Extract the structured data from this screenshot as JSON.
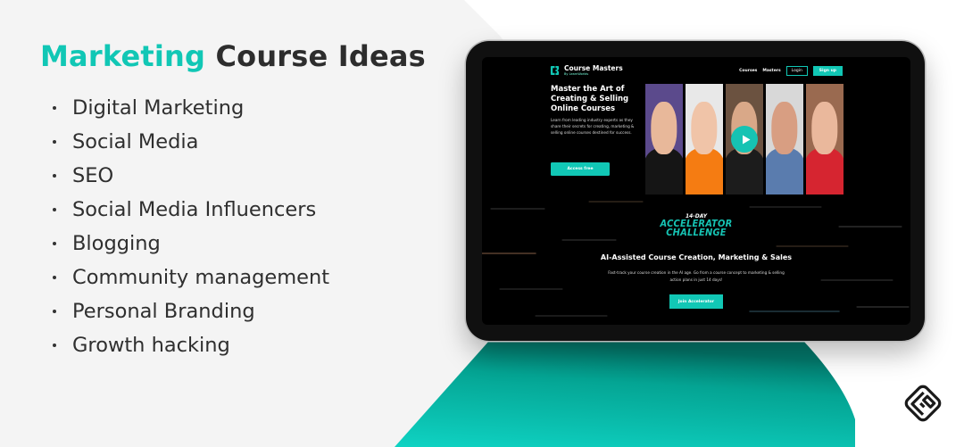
{
  "graphic": {
    "title_accent": "Marketing",
    "title_rest": " Course Ideas",
    "ideas": [
      "Digital Marketing",
      "Social Media",
      "SEO",
      "Social Media Influencers",
      "Blogging",
      "Community management",
      "Personal Branding",
      "Growth hacking"
    ],
    "accent_color": "#11c7b5"
  },
  "site": {
    "brand_name": "Course Masters",
    "brand_sub": "By LearnWorlds",
    "nav": {
      "courses": "Courses",
      "masters": "Masters",
      "login": "Login",
      "signup": "Sign up"
    },
    "hero": {
      "heading": "Master the Art of Creating & Selling Online Courses",
      "body": "Learn from leading industry experts as they share their secrets for creating, marketing & selling online courses destined for success.",
      "cta": "Access free"
    },
    "masters": [
      {
        "name": "master-1",
        "bg": "#5b4a8c",
        "skin": "#e8b89a",
        "clothes": "#151515"
      },
      {
        "name": "master-2",
        "bg": "#e8e8e8",
        "skin": "#f0c4a8",
        "clothes": "#f57c12"
      },
      {
        "name": "master-3",
        "bg": "#6b5240",
        "skin": "#d9a888",
        "clothes": "#1c1c1c"
      },
      {
        "name": "master-4",
        "bg": "#d8d8d8",
        "skin": "#d89e82",
        "clothes": "#5a7cae"
      },
      {
        "name": "master-5",
        "bg": "#9a6a50",
        "skin": "#eab89c",
        "clothes": "#d62530"
      }
    ],
    "challenge": {
      "small": "14-DAY",
      "line1": "ACCELERATOR",
      "line2": "CHALLENGE"
    },
    "accelerator": {
      "heading": "AI-Assisted Course Creation, Marketing & Sales",
      "body": "Fast-track your course creation in the AI age. Go from a course concept to marketing & selling action plans in just 14 days!",
      "cta": "Join Accelerator"
    }
  }
}
